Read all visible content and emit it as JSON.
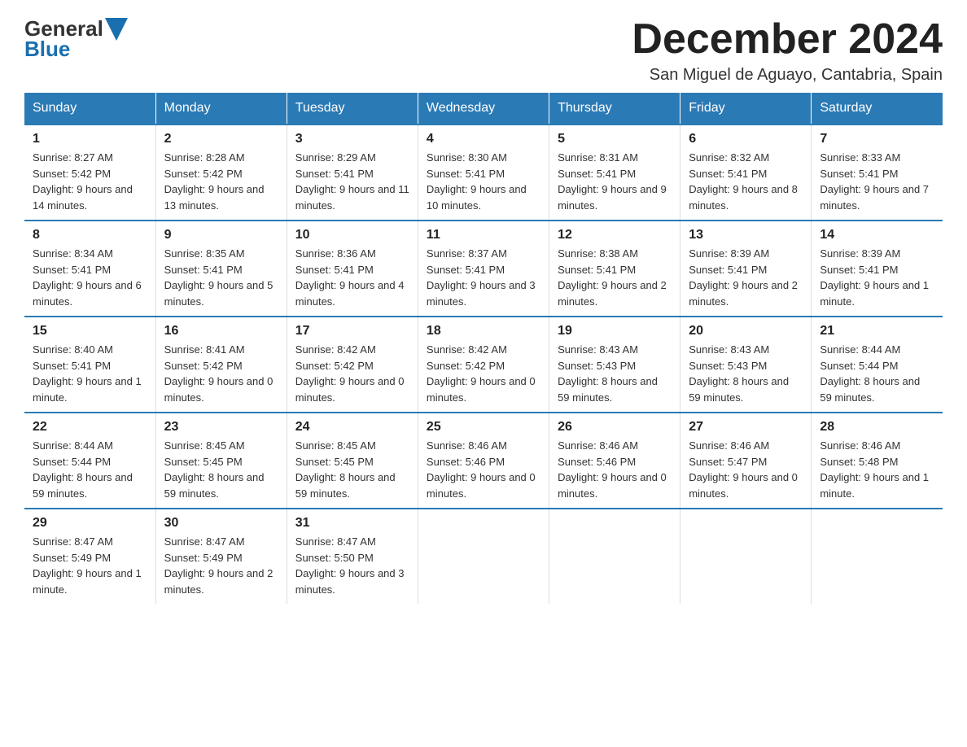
{
  "header": {
    "logo_general": "General",
    "logo_blue": "Blue",
    "title": "December 2024",
    "subtitle": "San Miguel de Aguayo, Cantabria, Spain"
  },
  "days_of_week": [
    "Sunday",
    "Monday",
    "Tuesday",
    "Wednesday",
    "Thursday",
    "Friday",
    "Saturday"
  ],
  "weeks": [
    [
      {
        "day": "1",
        "sunrise": "8:27 AM",
        "sunset": "5:42 PM",
        "daylight": "9 hours and 14 minutes."
      },
      {
        "day": "2",
        "sunrise": "8:28 AM",
        "sunset": "5:42 PM",
        "daylight": "9 hours and 13 minutes."
      },
      {
        "day": "3",
        "sunrise": "8:29 AM",
        "sunset": "5:41 PM",
        "daylight": "9 hours and 11 minutes."
      },
      {
        "day": "4",
        "sunrise": "8:30 AM",
        "sunset": "5:41 PM",
        "daylight": "9 hours and 10 minutes."
      },
      {
        "day": "5",
        "sunrise": "8:31 AM",
        "sunset": "5:41 PM",
        "daylight": "9 hours and 9 minutes."
      },
      {
        "day": "6",
        "sunrise": "8:32 AM",
        "sunset": "5:41 PM",
        "daylight": "9 hours and 8 minutes."
      },
      {
        "day": "7",
        "sunrise": "8:33 AM",
        "sunset": "5:41 PM",
        "daylight": "9 hours and 7 minutes."
      }
    ],
    [
      {
        "day": "8",
        "sunrise": "8:34 AM",
        "sunset": "5:41 PM",
        "daylight": "9 hours and 6 minutes."
      },
      {
        "day": "9",
        "sunrise": "8:35 AM",
        "sunset": "5:41 PM",
        "daylight": "9 hours and 5 minutes."
      },
      {
        "day": "10",
        "sunrise": "8:36 AM",
        "sunset": "5:41 PM",
        "daylight": "9 hours and 4 minutes."
      },
      {
        "day": "11",
        "sunrise": "8:37 AM",
        "sunset": "5:41 PM",
        "daylight": "9 hours and 3 minutes."
      },
      {
        "day": "12",
        "sunrise": "8:38 AM",
        "sunset": "5:41 PM",
        "daylight": "9 hours and 2 minutes."
      },
      {
        "day": "13",
        "sunrise": "8:39 AM",
        "sunset": "5:41 PM",
        "daylight": "9 hours and 2 minutes."
      },
      {
        "day": "14",
        "sunrise": "8:39 AM",
        "sunset": "5:41 PM",
        "daylight": "9 hours and 1 minute."
      }
    ],
    [
      {
        "day": "15",
        "sunrise": "8:40 AM",
        "sunset": "5:41 PM",
        "daylight": "9 hours and 1 minute."
      },
      {
        "day": "16",
        "sunrise": "8:41 AM",
        "sunset": "5:42 PM",
        "daylight": "9 hours and 0 minutes."
      },
      {
        "day": "17",
        "sunrise": "8:42 AM",
        "sunset": "5:42 PM",
        "daylight": "9 hours and 0 minutes."
      },
      {
        "day": "18",
        "sunrise": "8:42 AM",
        "sunset": "5:42 PM",
        "daylight": "9 hours and 0 minutes."
      },
      {
        "day": "19",
        "sunrise": "8:43 AM",
        "sunset": "5:43 PM",
        "daylight": "8 hours and 59 minutes."
      },
      {
        "day": "20",
        "sunrise": "8:43 AM",
        "sunset": "5:43 PM",
        "daylight": "8 hours and 59 minutes."
      },
      {
        "day": "21",
        "sunrise": "8:44 AM",
        "sunset": "5:44 PM",
        "daylight": "8 hours and 59 minutes."
      }
    ],
    [
      {
        "day": "22",
        "sunrise": "8:44 AM",
        "sunset": "5:44 PM",
        "daylight": "8 hours and 59 minutes."
      },
      {
        "day": "23",
        "sunrise": "8:45 AM",
        "sunset": "5:45 PM",
        "daylight": "8 hours and 59 minutes."
      },
      {
        "day": "24",
        "sunrise": "8:45 AM",
        "sunset": "5:45 PM",
        "daylight": "8 hours and 59 minutes."
      },
      {
        "day": "25",
        "sunrise": "8:46 AM",
        "sunset": "5:46 PM",
        "daylight": "9 hours and 0 minutes."
      },
      {
        "day": "26",
        "sunrise": "8:46 AM",
        "sunset": "5:46 PM",
        "daylight": "9 hours and 0 minutes."
      },
      {
        "day": "27",
        "sunrise": "8:46 AM",
        "sunset": "5:47 PM",
        "daylight": "9 hours and 0 minutes."
      },
      {
        "day": "28",
        "sunrise": "8:46 AM",
        "sunset": "5:48 PM",
        "daylight": "9 hours and 1 minute."
      }
    ],
    [
      {
        "day": "29",
        "sunrise": "8:47 AM",
        "sunset": "5:49 PM",
        "daylight": "9 hours and 1 minute."
      },
      {
        "day": "30",
        "sunrise": "8:47 AM",
        "sunset": "5:49 PM",
        "daylight": "9 hours and 2 minutes."
      },
      {
        "day": "31",
        "sunrise": "8:47 AM",
        "sunset": "5:50 PM",
        "daylight": "9 hours and 3 minutes."
      },
      null,
      null,
      null,
      null
    ]
  ]
}
